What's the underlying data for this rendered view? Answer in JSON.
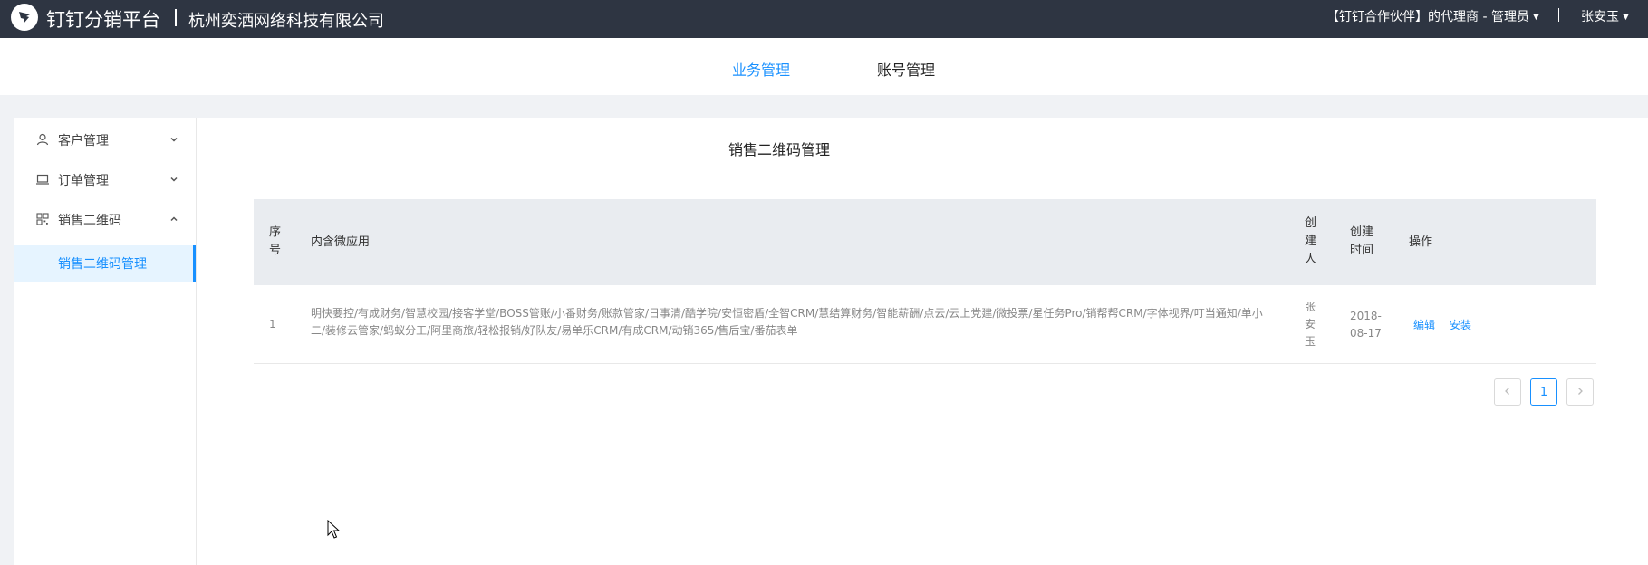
{
  "header": {
    "brand": "钉钉分销平台",
    "company": "杭州奕洒网络科技有限公司",
    "role": "【钉钉合作伙伴】的代理商 - 管理员",
    "user": "张安玉"
  },
  "nav": {
    "tabs": [
      {
        "label": "业务管理",
        "active": true
      },
      {
        "label": "账号管理",
        "active": false
      }
    ]
  },
  "sidebar": {
    "items": [
      {
        "label": "客户管理",
        "icon": "user-icon"
      },
      {
        "label": "订单管理",
        "icon": "laptop-icon"
      },
      {
        "label": "销售二维码",
        "icon": "qrcode-icon",
        "expanded": true
      }
    ],
    "subitem": {
      "label": "销售二维码管理"
    }
  },
  "page": {
    "title": "销售二维码管理"
  },
  "table": {
    "headers": {
      "index": "序号",
      "apps": "内含微应用",
      "creator": "创建人",
      "created_time": "创建时间",
      "actions": "操作"
    },
    "rows": [
      {
        "index": "1",
        "apps": "明快要控/有成财务/智慧校园/接客学堂/BOSS管账/小番财务/账款管家/日事清/酷学院/安恒密盾/全智CRM/慧结算财务/智能薪酬/点云/云上党建/微投票/星任务Pro/销帮帮CRM/字体视界/叮当通知/单小二/装修云管家/蚂蚁分工/阿里商旅/轻松报销/好队友/易单乐CRM/有成CRM/动销365/售后宝/番茄表单",
        "creator": "张安玉",
        "created_time": "2018-08-17",
        "action_edit": "编辑",
        "action_install": "安装"
      }
    ]
  },
  "pagination": {
    "current": "1"
  },
  "colors": {
    "topbar": "#2e3542",
    "accent": "#1890ff",
    "page_bg": "#f0f2f5",
    "table_head_bg": "#e9ecf0"
  }
}
